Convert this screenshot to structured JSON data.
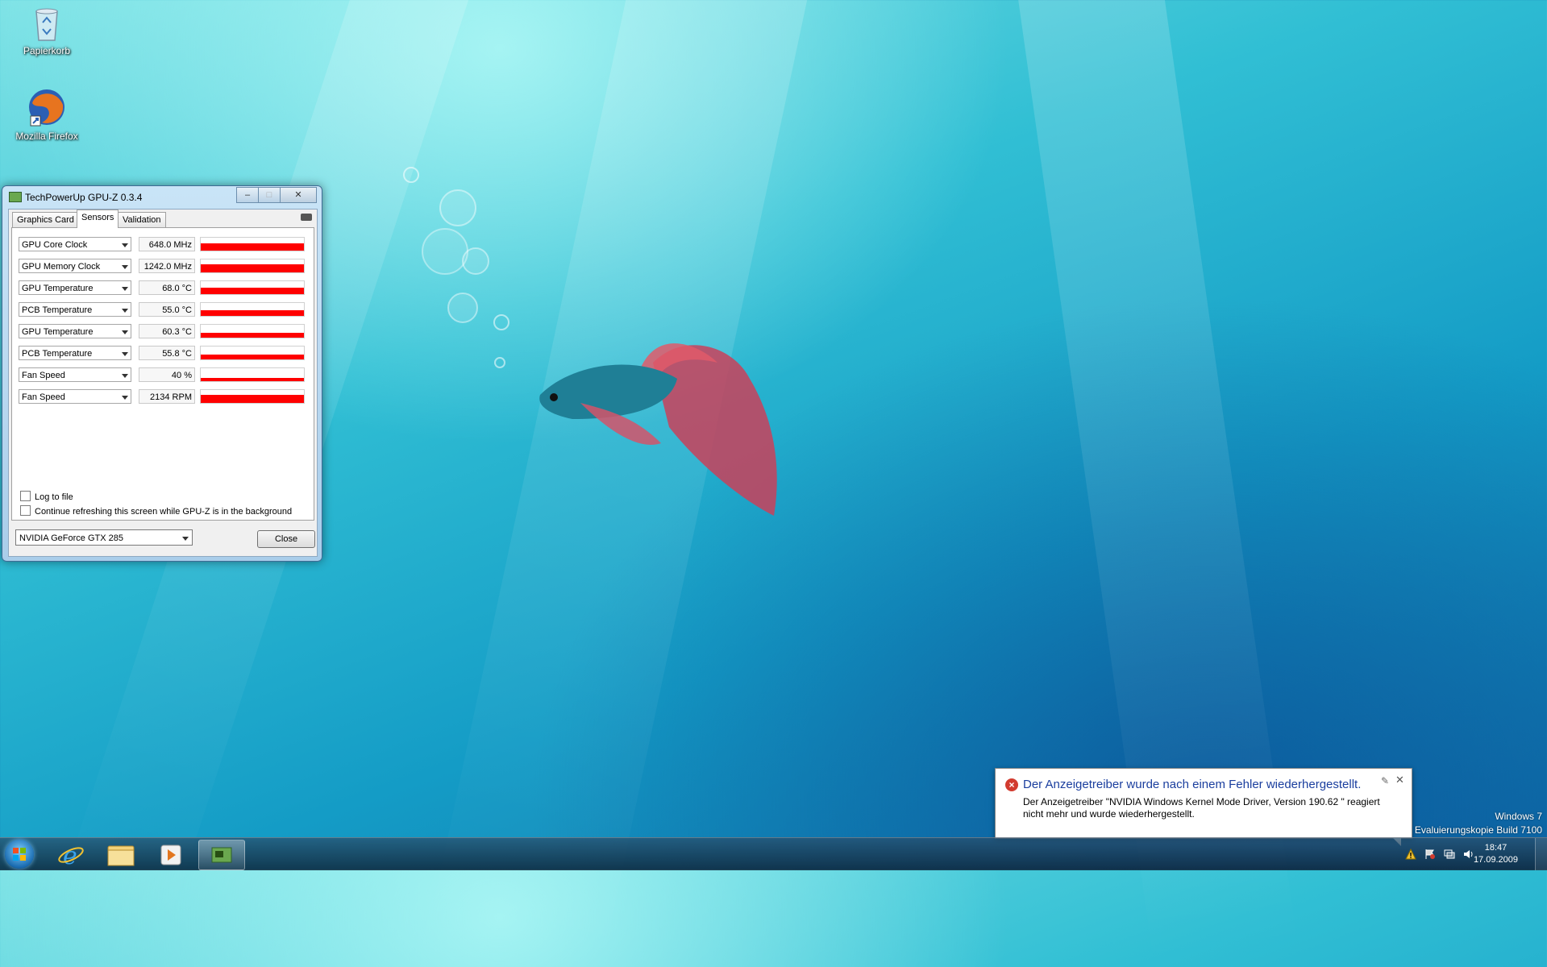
{
  "desktop": {
    "icons": [
      {
        "label": "Papierkorb",
        "icon": "recycle-bin-icon"
      },
      {
        "label": "Mozilla Firefox",
        "icon": "firefox-icon"
      }
    ],
    "watermark": {
      "line1": "Windows 7",
      "line2": "Evaluierungskopie Build 7100"
    }
  },
  "window": {
    "title": "TechPowerUp GPU-Z 0.3.4",
    "controls": {
      "minimize": "–",
      "maximize": "□",
      "close": "✕"
    },
    "tabs": [
      {
        "label": "Graphics Card",
        "active": false
      },
      {
        "label": "Sensors",
        "active": true
      },
      {
        "label": "Validation",
        "active": false
      }
    ],
    "sensors": [
      {
        "name": "GPU Core Clock",
        "value": "648.0 MHz",
        "level": 0.55
      },
      {
        "name": "GPU Memory Clock",
        "value": "1242.0 MHz",
        "level": 0.62
      },
      {
        "name": "GPU Temperature",
        "value": "68.0 °C",
        "level": 0.48
      },
      {
        "name": "PCB Temperature",
        "value": "55.0 °C",
        "level": 0.45
      },
      {
        "name": "GPU Temperature",
        "value": "60.3 °C",
        "level": 0.38
      },
      {
        "name": "PCB Temperature",
        "value": "55.8 °C",
        "level": 0.35
      },
      {
        "name": "Fan Speed",
        "value": "40 %",
        "level": 0.28
      },
      {
        "name": "Fan Speed",
        "value": "2134 RPM",
        "level": 0.6
      }
    ],
    "options": {
      "log_to_file": "Log to file",
      "continue_refresh": "Continue refreshing this screen while GPU-Z is in the background"
    },
    "gpu_select": "NVIDIA GeForce GTX 285",
    "close_label": "Close"
  },
  "notification": {
    "title": "Der Anzeigetreiber wurde nach einem Fehler wiederhergestellt.",
    "body": "Der Anzeigetreiber \"NVIDIA Windows Kernel Mode Driver, Version 190.62 \" reagiert nicht mehr und wurde wiederhergestellt.",
    "icon": "error-icon"
  },
  "taskbar": {
    "pinned": [
      "internet-explorer-icon",
      "explorer-folder-icon",
      "media-player-icon",
      "gpu-z-icon"
    ],
    "clock_time": "18:47",
    "clock_date": "17.09.2009"
  },
  "colors": {
    "sensor_graph": "#ff0000",
    "notification_title": "#1a3e9e"
  }
}
